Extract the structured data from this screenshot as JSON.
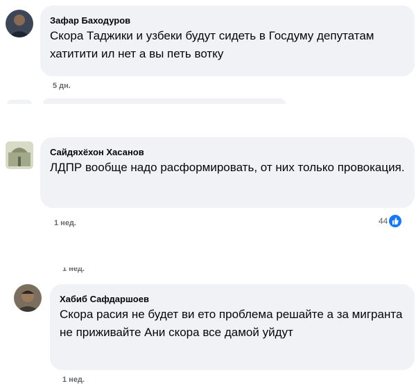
{
  "comments": [
    {
      "author": "Зафар Баходуров",
      "text": "Скора Таджики и узбеки будут сидеть в Госдуму депутатам хатитити ил нет а вы петь вотку",
      "time": "5 дн."
    },
    {
      "author": "Сайдяхёхон Хасанов",
      "text": "ЛДПР вообще надо расформировать, от них только провокация.",
      "time": "1 нед.",
      "reactions": "44"
    },
    {
      "author": "Хабиб Сафдаршоев",
      "text": "Скора расия не будет ви ето проблема решайте а за мигранта не приживайте Ани скора все дамой уйдут",
      "time": "1 нед."
    }
  ],
  "partial_time": "1 нед.",
  "icons": {
    "reaction": "like-icon"
  },
  "colors": {
    "bubble": "#f0f2f5",
    "like": "#1877f2",
    "meta": "#65676b"
  }
}
